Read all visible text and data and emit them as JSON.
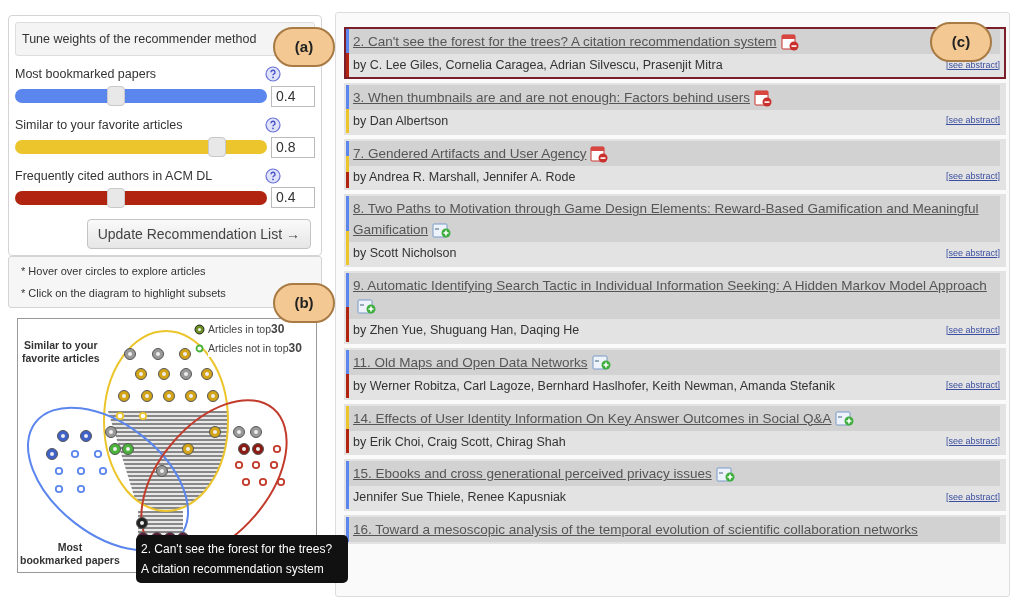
{
  "weights_panel": {
    "title": "Tune weights of the recommender method",
    "sliders": [
      {
        "label": "Most bookmarked papers",
        "color": "#5b86ee",
        "level": 0.4,
        "value": "0.4"
      },
      {
        "label": "Similar to your favorite articles",
        "color": "#ecc52c",
        "level": 0.8,
        "value": "0.8"
      },
      {
        "label": "Frequently cited authors in ACM DL",
        "color": "#b02410",
        "level": 0.4,
        "value": "0.4"
      }
    ],
    "button": "Update Recommendation List →"
  },
  "hints": [
    "* Hover over circles to explore articles",
    "* Click on the diagram to highlight subsets"
  ],
  "venn": {
    "legend": [
      {
        "kind": "in",
        "label": "Articles in top",
        "number": "30"
      },
      {
        "kind": "out",
        "label": "Articles not in top",
        "number": "30"
      }
    ],
    "set_labels": [
      {
        "kind": "favorites",
        "lines": [
          "Similar to your",
          "favorite articles"
        ]
      },
      {
        "kind": "bookmarked",
        "lines": [
          "Most",
          "bookmarked papers"
        ]
      }
    ],
    "tooltip": [
      "2. Can't see the forest for the trees?",
      "A citation recommendation system"
    ]
  },
  "annotations": [
    "(a)",
    "(b)",
    "(c)"
  ],
  "articles": [
    {
      "title": "2. Can't see the forest for the trees? A citation recommendation system",
      "authors": "by C. Lee Giles, Cornelia Caragea, Adrian Silvescu, Prasenjit Mitra",
      "link": "[see abstract]",
      "kind": "remove",
      "selected": true,
      "strips": [
        {
          "color": "#5b86ee"
        },
        {
          "color": "#b02410"
        }
      ]
    },
    {
      "title": "3. When thumbnails are and are not enough: Factors behind users",
      "authors": "by Dan Albertson",
      "link": "[see abstract]",
      "kind": "remove",
      "selected": false,
      "strips": [
        {
          "color": "#5b86ee"
        },
        {
          "color": "#ecc52c"
        }
      ]
    },
    {
      "title": "7. Gendered Artifacts and User Agency",
      "authors": "by Andrea R. Marshall, Jennifer A. Rode",
      "link": "[see abstract]",
      "kind": "remove",
      "selected": false,
      "strips": [
        {
          "color": "#5b86ee"
        },
        {
          "color": "#ecc52c"
        },
        {
          "color": "#b02410"
        }
      ]
    },
    {
      "title": "8. Two Paths to Motivation through Game Design Elements: Reward-Based Gamification and Meaningful Gamification",
      "authors": "by Scott Nicholson",
      "link": "[see abstract]",
      "kind": "add",
      "selected": false,
      "strips": [
        {
          "color": "#5b86ee"
        },
        {
          "color": "#ecc52c"
        }
      ]
    },
    {
      "title": "9. Automatic Identifying Search Tactic in Individual Information Seeking: A Hidden Markov Model Approach",
      "authors": "by Zhen Yue, Shuguang Han, Daqing He",
      "link": "[see abstract]",
      "kind": "add",
      "selected": false,
      "strips": [
        {
          "color": "#5b86ee"
        },
        {
          "color": "#b02410"
        }
      ]
    },
    {
      "title": "11. Old Maps and Open Data Networks",
      "authors": "by Werner Robitza, Carl Lagoze, Bernhard Haslhofer, Keith Newman, Amanda Stefanik",
      "link": "[see abstract]",
      "kind": "add",
      "selected": false,
      "strips": [
        {
          "color": "#5b86ee"
        },
        {
          "color": "#b02410"
        }
      ]
    },
    {
      "title": "14. Effects of User Identity Information On Key Answer Outcomes in Social Q&A",
      "authors": "by Erik Choi, Craig Scott, Chirag Shah",
      "link": "[see abstract]",
      "kind": "add",
      "selected": false,
      "strips": [
        {
          "color": "#ecc52c"
        },
        {
          "color": "#b02410"
        }
      ]
    },
    {
      "title": "15. Ebooks and cross generational perceived privacy issues",
      "authors": "Jennifer Sue Thiele, Renee Kapusniak",
      "link": "[see abstract]",
      "kind": "add",
      "selected": false,
      "strips": [
        {
          "color": "#5b86ee"
        }
      ]
    },
    {
      "title": "16. Toward a mesoscopic analysis of the temporal evolution of scientific collaboration networks",
      "selected": false,
      "strips": [
        {
          "color": "#5b86ee"
        }
      ]
    }
  ]
}
